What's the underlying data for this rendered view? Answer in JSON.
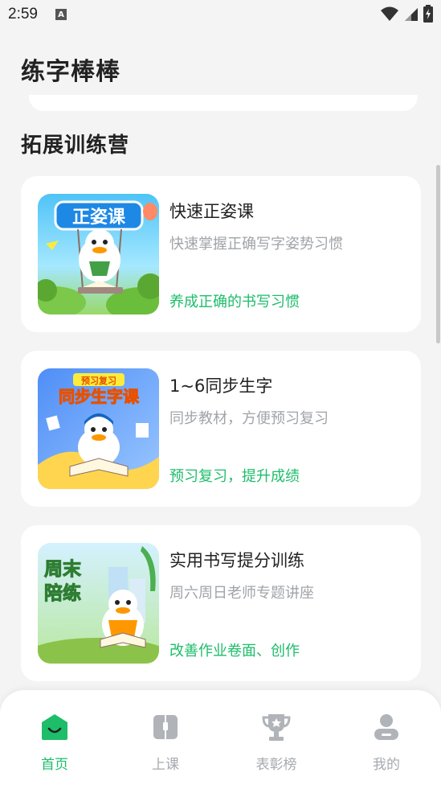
{
  "status_bar": {
    "time": "2:59",
    "notification_icon": "a-badge-icon",
    "icons": [
      "wifi-icon",
      "signal-icon",
      "battery-icon"
    ]
  },
  "app": {
    "title": "练字棒棒"
  },
  "section": {
    "title": "拓展训练营"
  },
  "cards": [
    {
      "title": "快速正姿课",
      "subtitle": "快速掌握正确写字姿势习惯",
      "tag": "养成正确的书写习惯",
      "thumb_text": "正姿课"
    },
    {
      "title": "1~6同步生字",
      "subtitle": "同步教材，方便预习复习",
      "tag": "预习复习，提升成绩",
      "thumb_text": "同步生字课",
      "thumb_badge": "预习复习"
    },
    {
      "title": "实用书写提分训练",
      "subtitle": "周六周日老师专题讲座",
      "tag": "改善作业卷面、创作",
      "thumb_text_line1": "周末",
      "thumb_text_line2": "陪练"
    }
  ],
  "bottom_nav": [
    {
      "label": "首页",
      "icon": "home-icon",
      "active": true
    },
    {
      "label": "上课",
      "icon": "book-icon",
      "active": false
    },
    {
      "label": "表彰榜",
      "icon": "trophy-icon",
      "active": false
    },
    {
      "label": "我的",
      "icon": "user-icon",
      "active": false
    }
  ],
  "colors": {
    "accent": "#1dbd6a",
    "background": "#f3f4f3",
    "card": "#ffffff",
    "subtitle": "#a0a4a8",
    "nav_inactive": "#a6aaae"
  }
}
